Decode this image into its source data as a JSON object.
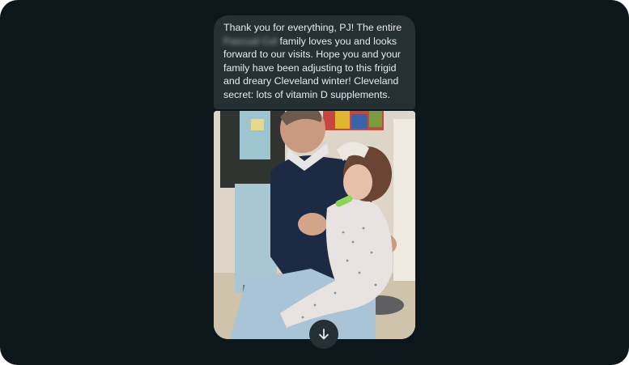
{
  "message": {
    "text_before_name": "Thank you for everything, PJ! The entire",
    "redacted_name": "Pascual Cohn",
    "text_after_name": "family loves you and looks forward to our visits. Hope you and your family have been adjusting to this frigid and dreary Cleveland winter! Cleveland secret: lots of vitamin D supplements."
  },
  "photo": {
    "subject": "photo-attachment"
  },
  "scroll_button": {
    "icon": "arrow-down-icon"
  },
  "colors": {
    "background": "#0b171b",
    "bubble": "#253035",
    "text": "#e6ebed"
  }
}
